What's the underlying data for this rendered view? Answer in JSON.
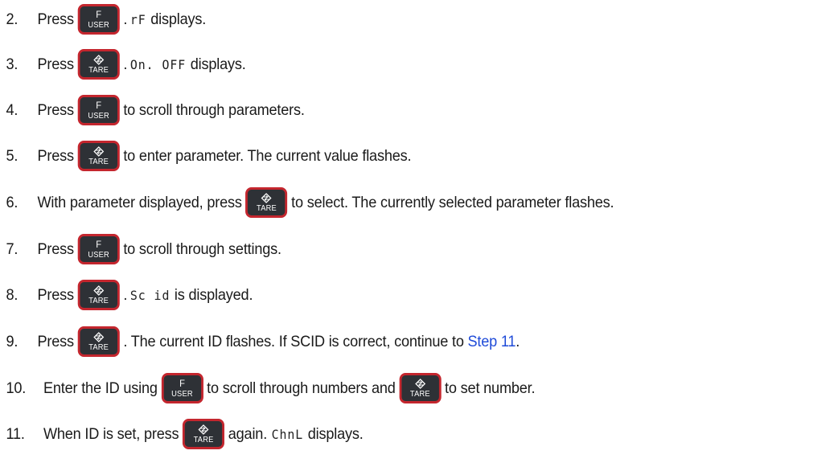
{
  "keys": {
    "f_top": "F",
    "f_bottom": "USER",
    "tare_bottom": "TARE",
    "f_icon": "f-user-key-icon",
    "tare_icon": "tare-key-icon",
    "key_color": "#2e3136",
    "key_border_color": "#c4262e"
  },
  "link_color": "#1f4bd8",
  "steps": [
    {
      "num": "2.",
      "pre": "Press",
      "post_dot": ".",
      "display": "rF",
      "post": "displays."
    },
    {
      "num": "3.",
      "pre": "Press",
      "post_dot": ".",
      "display": "On. OFF",
      "post": "displays."
    },
    {
      "num": "4.",
      "pre": "Press",
      "post": "to scroll through parameters."
    },
    {
      "num": "5.",
      "pre": "Press",
      "post": "to enter parameter. The current value flashes."
    },
    {
      "num": "6.",
      "pre": "With parameter displayed, press",
      "post": "to select. The currently selected parameter flashes."
    },
    {
      "num": "7.",
      "pre": "Press",
      "post": "to scroll through settings."
    },
    {
      "num": "8.",
      "pre": "Press",
      "post_dot": ".",
      "display": "Sc id",
      "post": "is displayed."
    },
    {
      "num": "9.",
      "pre": "Press",
      "post": ". The current ID flashes. If SCID is correct, continue to",
      "link": "Step 11",
      "post2": "."
    },
    {
      "num": "10.",
      "pre": "Enter the ID using",
      "mid": "to scroll through numbers and",
      "post": "to set number."
    },
    {
      "num": "11.",
      "pre": "When ID is set, press",
      "post": "again.",
      "display": "ChnL",
      "post2": "displays."
    }
  ]
}
